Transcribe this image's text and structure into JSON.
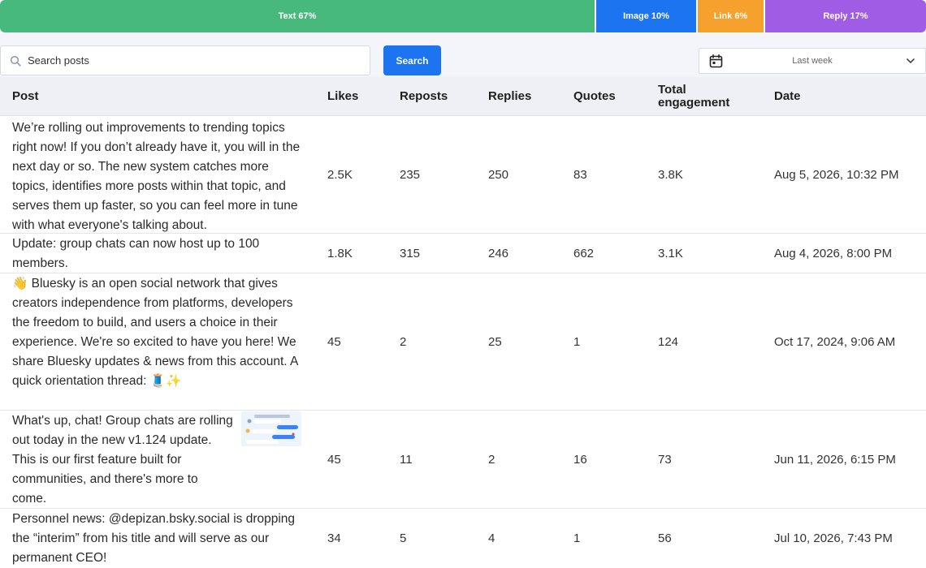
{
  "distribution": {
    "text": "Text 67%",
    "image": "Image 10%",
    "link": "Link 6%",
    "reply": "Reply 17%"
  },
  "colors": {
    "text": "#48b97c",
    "image": "#1c74f0",
    "link": "#f6a12d",
    "reply": "#9f5de5",
    "accent": "#1c74f0"
  },
  "search": {
    "placeholder": "Search posts",
    "button_label": "Search"
  },
  "date_filter": {
    "value": "Last week",
    "icon": "calendar-icon"
  },
  "table": {
    "columns": [
      "Post",
      "Likes",
      "Reposts",
      "Replies",
      "Quotes",
      "Total engagement",
      "Date"
    ],
    "rows": [
      {
        "post": "We’re rolling out improvements to trending topics right now! If you don’t already have it, you will in the next day or so. The new system catches more topics, identifies more posts within that topic, and serves them up faster, so you can feel more in tune with what everyone's talking about.",
        "likes": "2.5K",
        "reposts": "235",
        "replies": "250",
        "quotes": "83",
        "total": "3.8K",
        "date": "Aug 5, 2026, 10:32 PM"
      },
      {
        "post": "Update: group chats can now host up to 100 members.",
        "likes": "1.8K",
        "reposts": "315",
        "replies": "246",
        "quotes": "662",
        "total": "3.1K",
        "date": "Aug 4, 2026, 8:00 PM"
      },
      {
        "post": "👋 Bluesky is an open social network that gives creators independence from platforms, developers the freedom to build, and users a choice in their experience. We're so excited to have you here! We share Bluesky updates & news from this account. A quick orientation thread: 🧵✨",
        "likes": "45",
        "reposts": "2",
        "replies": "25",
        "quotes": "1",
        "total": "124",
        "date": "Oct 17, 2024, 9:06 AM"
      },
      {
        "post": "What's up, chat! Group chats are rolling out today in the new v1.124 update. This is our first feature built for communities, and there's more to come.",
        "likes": "45",
        "reposts": "11",
        "replies": "2",
        "quotes": "16",
        "total": "73",
        "date": "Jun 11, 2026, 6:15 PM"
      },
      {
        "post": "Personnel news: @depizan.bsky.social is dropping the “interim” from his title and will serve as our permanent CEO!",
        "likes": "34",
        "reposts": "5",
        "replies": "4",
        "quotes": "1",
        "total": "56",
        "date": "Jul 10, 2026, 7:43 PM"
      }
    ]
  }
}
